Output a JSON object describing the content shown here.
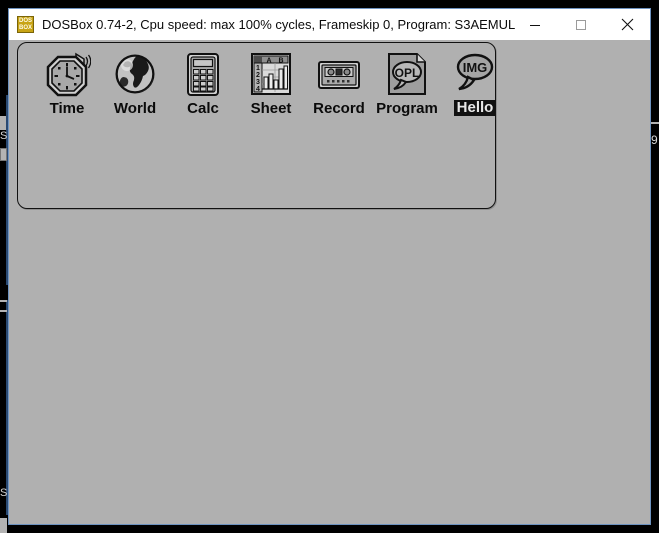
{
  "window": {
    "title": "DOSBox 0.74-2, Cpu speed: max 100% cycles, Frameskip  0, Program:  S3AEMUL",
    "icon_name": "dosbox-icon",
    "icon_line1": "DOS",
    "icon_line2": "BOX",
    "icon_color": "#c8a415",
    "titlebar_bg": "#ffffff",
    "border_color": "#6e93c0",
    "controls": [
      {
        "name": "minimize-button",
        "glyph": "minimize"
      },
      {
        "name": "maximize-button",
        "glyph": "maximize"
      },
      {
        "name": "close-button",
        "glyph": "close"
      }
    ]
  },
  "emulator": {
    "screen_bg": "#b0b0b0",
    "panel_border": "#111111",
    "back_arrow_name": "back-arrow-icon",
    "apps": [
      {
        "name": "time",
        "label": "Time",
        "icon": "clock-alarm-icon",
        "selected": false
      },
      {
        "name": "world",
        "label": "World",
        "icon": "globe-icon",
        "selected": false
      },
      {
        "name": "calc",
        "label": "Calc",
        "icon": "calculator-icon",
        "selected": false
      },
      {
        "name": "sheet",
        "label": "Sheet",
        "icon": "spreadsheet-icon",
        "selected": false
      },
      {
        "name": "record",
        "label": "Record",
        "icon": "cassette-tape-icon",
        "selected": false
      },
      {
        "name": "program",
        "label": "Program",
        "icon": "opl-document-icon",
        "selected": false
      },
      {
        "name": "hello",
        "label": "Hello",
        "icon": "img-bubble-icon",
        "selected": true
      }
    ],
    "sheet_icon": {
      "columns": [
        "A",
        "B"
      ],
      "rows": [
        "1",
        "2",
        "3",
        "4"
      ]
    },
    "program_icon_text": "OPL",
    "hello_icon_text": "IMG"
  },
  "desktop": {
    "background": "#000000",
    "edge_text_right": "9",
    "edge_text_left_top": "S",
    "edge_text_left_bottom": "S",
    "accent": "#2b4a72"
  }
}
